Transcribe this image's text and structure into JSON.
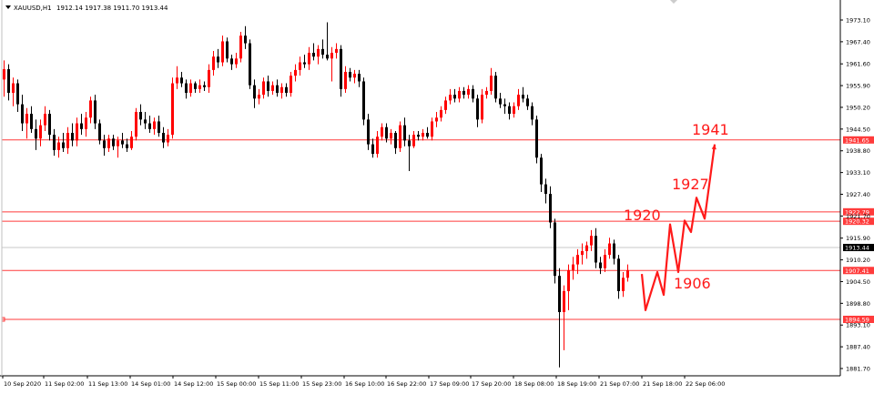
{
  "window": {
    "symbol_label": "XAUUSD,H1",
    "ohlc": "1912.14 1917.38 1911.70 1913.44"
  },
  "colors": {
    "bull": "#ff0000",
    "bear": "#000000",
    "level_line": "#ff3b3b",
    "annotation": "#ff1a1a",
    "axis": "#000000",
    "current_price_tag": "#000000"
  },
  "chart_data": {
    "type": "candlestick",
    "title": "XAUUSD,H1",
    "ohlc_readout": "1912.14 1917.38 1911.70 1913.44",
    "ylim": [
      1879.0,
      1977.0
    ],
    "y_ticks": [
      "1973.10",
      "1967.40",
      "1961.60",
      "1955.90",
      "1950.20",
      "1944.50",
      "1938.80",
      "1933.10",
      "1927.40",
      "1921.70",
      "1915.90",
      "1910.20",
      "1904.50",
      "1898.80",
      "1893.10",
      "1887.40",
      "1881.70"
    ],
    "x_ticks": [
      "10 Sep 2020",
      "11 Sep 02:00",
      "11 Sep 13:00",
      "14 Sep 01:00",
      "14 Sep 12:00",
      "15 Sep 00:00",
      "15 Sep 11:00",
      "15 Sep 23:00",
      "16 Sep 10:00",
      "16 Sep 22:00",
      "17 Sep 09:00",
      "17 Sep 20:00",
      "18 Sep 08:00",
      "18 Sep 19:00",
      "21 Sep 07:00",
      "21 Sep 18:00",
      "22 Sep 06:00"
    ],
    "levels": [
      {
        "label": "1941.65",
        "value": 1941.65
      },
      {
        "label": "1922.79",
        "value": 1922.79
      },
      {
        "label": "1920.32",
        "value": 1920.32
      },
      {
        "label": "1907.41",
        "value": 1907.41
      },
      {
        "label": "1894.59",
        "value": 1894.59
      }
    ],
    "current_price": {
      "label": "1913.44",
      "value": 1913.44
    },
    "annotations": [
      {
        "text": "1941"
      },
      {
        "text": "1927"
      },
      {
        "text": "1920"
      },
      {
        "text": "1906"
      }
    ],
    "projection_path": [
      1906.5,
      1897.0,
      1907.0,
      1901.0,
      1919.5,
      1907.0,
      1920.5,
      1917.5,
      1926.5,
      1921.0,
      1940.5
    ],
    "candles": [
      {
        "o": 1957.5,
        "h": 1962.5,
        "l": 1953.0,
        "c": 1960.2
      },
      {
        "o": 1960.2,
        "h": 1961.5,
        "l": 1952.0,
        "c": 1954.0
      },
      {
        "o": 1954.0,
        "h": 1958.0,
        "l": 1950.5,
        "c": 1956.5
      },
      {
        "o": 1956.5,
        "h": 1957.5,
        "l": 1949.0,
        "c": 1951.0
      },
      {
        "o": 1951.0,
        "h": 1953.5,
        "l": 1944.0,
        "c": 1946.0
      },
      {
        "o": 1946.0,
        "h": 1950.0,
        "l": 1942.0,
        "c": 1948.5
      },
      {
        "o": 1948.5,
        "h": 1950.5,
        "l": 1943.5,
        "c": 1944.5
      },
      {
        "o": 1944.5,
        "h": 1947.0,
        "l": 1939.0,
        "c": 1942.0
      },
      {
        "o": 1942.0,
        "h": 1947.0,
        "l": 1940.0,
        "c": 1945.5
      },
      {
        "o": 1945.5,
        "h": 1950.5,
        "l": 1944.0,
        "c": 1948.5
      },
      {
        "o": 1948.5,
        "h": 1949.5,
        "l": 1941.5,
        "c": 1943.0
      },
      {
        "o": 1943.0,
        "h": 1944.5,
        "l": 1937.5,
        "c": 1939.0
      },
      {
        "o": 1939.0,
        "h": 1942.5,
        "l": 1937.0,
        "c": 1941.0
      },
      {
        "o": 1941.0,
        "h": 1943.5,
        "l": 1938.5,
        "c": 1939.5
      },
      {
        "o": 1939.5,
        "h": 1945.0,
        "l": 1938.0,
        "c": 1943.5
      },
      {
        "o": 1943.5,
        "h": 1946.0,
        "l": 1940.0,
        "c": 1941.5
      },
      {
        "o": 1941.5,
        "h": 1947.5,
        "l": 1940.0,
        "c": 1946.0
      },
      {
        "o": 1946.0,
        "h": 1948.5,
        "l": 1943.0,
        "c": 1944.5
      },
      {
        "o": 1944.5,
        "h": 1949.0,
        "l": 1942.5,
        "c": 1947.5
      },
      {
        "o": 1947.5,
        "h": 1953.0,
        "l": 1946.0,
        "c": 1952.0
      },
      {
        "o": 1952.0,
        "h": 1953.5,
        "l": 1944.5,
        "c": 1946.0
      },
      {
        "o": 1946.0,
        "h": 1947.0,
        "l": 1940.5,
        "c": 1941.5
      },
      {
        "o": 1941.5,
        "h": 1943.0,
        "l": 1937.5,
        "c": 1939.5
      },
      {
        "o": 1939.5,
        "h": 1943.0,
        "l": 1938.5,
        "c": 1942.0
      },
      {
        "o": 1942.0,
        "h": 1943.0,
        "l": 1939.0,
        "c": 1940.0
      },
      {
        "o": 1940.0,
        "h": 1942.5,
        "l": 1937.0,
        "c": 1941.5
      },
      {
        "o": 1941.5,
        "h": 1943.5,
        "l": 1939.5,
        "c": 1940.5
      },
      {
        "o": 1940.5,
        "h": 1942.0,
        "l": 1938.5,
        "c": 1939.5
      },
      {
        "o": 1939.5,
        "h": 1944.0,
        "l": 1939.0,
        "c": 1942.5
      },
      {
        "o": 1942.5,
        "h": 1950.0,
        "l": 1941.5,
        "c": 1949.0
      },
      {
        "o": 1949.0,
        "h": 1951.0,
        "l": 1945.5,
        "c": 1947.0
      },
      {
        "o": 1947.0,
        "h": 1949.0,
        "l": 1944.5,
        "c": 1946.0
      },
      {
        "o": 1946.0,
        "h": 1948.0,
        "l": 1943.5,
        "c": 1944.5
      },
      {
        "o": 1944.5,
        "h": 1947.5,
        "l": 1943.0,
        "c": 1946.5
      },
      {
        "o": 1946.5,
        "h": 1948.0,
        "l": 1942.5,
        "c": 1943.5
      },
      {
        "o": 1943.5,
        "h": 1945.0,
        "l": 1939.5,
        "c": 1941.0
      },
      {
        "o": 1941.0,
        "h": 1944.5,
        "l": 1940.0,
        "c": 1943.0
      },
      {
        "o": 1943.0,
        "h": 1958.0,
        "l": 1942.0,
        "c": 1956.5
      },
      {
        "o": 1956.5,
        "h": 1961.0,
        "l": 1955.0,
        "c": 1958.0
      },
      {
        "o": 1958.0,
        "h": 1959.5,
        "l": 1955.5,
        "c": 1956.5
      },
      {
        "o": 1956.5,
        "h": 1957.5,
        "l": 1952.5,
        "c": 1954.0
      },
      {
        "o": 1954.0,
        "h": 1957.5,
        "l": 1953.0,
        "c": 1956.5
      },
      {
        "o": 1956.5,
        "h": 1957.0,
        "l": 1954.0,
        "c": 1955.0
      },
      {
        "o": 1955.0,
        "h": 1957.5,
        "l": 1954.0,
        "c": 1956.0
      },
      {
        "o": 1956.0,
        "h": 1957.0,
        "l": 1954.5,
        "c": 1955.5
      },
      {
        "o": 1955.5,
        "h": 1961.5,
        "l": 1954.0,
        "c": 1960.0
      },
      {
        "o": 1960.0,
        "h": 1965.0,
        "l": 1958.5,
        "c": 1963.5
      },
      {
        "o": 1963.5,
        "h": 1965.5,
        "l": 1960.5,
        "c": 1962.0
      },
      {
        "o": 1962.0,
        "h": 1969.0,
        "l": 1961.0,
        "c": 1967.5
      },
      {
        "o": 1967.5,
        "h": 1968.5,
        "l": 1962.0,
        "c": 1963.0
      },
      {
        "o": 1963.0,
        "h": 1964.0,
        "l": 1960.0,
        "c": 1961.5
      },
      {
        "o": 1961.5,
        "h": 1964.5,
        "l": 1960.5,
        "c": 1963.0
      },
      {
        "o": 1963.0,
        "h": 1970.0,
        "l": 1962.0,
        "c": 1969.0
      },
      {
        "o": 1969.0,
        "h": 1971.5,
        "l": 1965.5,
        "c": 1967.0
      },
      {
        "o": 1967.0,
        "h": 1968.0,
        "l": 1955.0,
        "c": 1956.0
      },
      {
        "o": 1956.0,
        "h": 1957.5,
        "l": 1950.0,
        "c": 1952.5
      },
      {
        "o": 1952.5,
        "h": 1955.0,
        "l": 1951.0,
        "c": 1953.5
      },
      {
        "o": 1953.5,
        "h": 1958.0,
        "l": 1952.5,
        "c": 1957.0
      },
      {
        "o": 1957.0,
        "h": 1958.5,
        "l": 1953.0,
        "c": 1954.5
      },
      {
        "o": 1954.5,
        "h": 1957.0,
        "l": 1953.5,
        "c": 1956.0
      },
      {
        "o": 1956.0,
        "h": 1957.5,
        "l": 1953.0,
        "c": 1954.0
      },
      {
        "o": 1954.0,
        "h": 1956.5,
        "l": 1952.5,
        "c": 1955.5
      },
      {
        "o": 1955.5,
        "h": 1956.5,
        "l": 1953.0,
        "c": 1954.0
      },
      {
        "o": 1954.0,
        "h": 1959.5,
        "l": 1953.0,
        "c": 1958.5
      },
      {
        "o": 1958.5,
        "h": 1961.5,
        "l": 1957.0,
        "c": 1960.0
      },
      {
        "o": 1960.0,
        "h": 1963.5,
        "l": 1958.5,
        "c": 1962.0
      },
      {
        "o": 1962.0,
        "h": 1964.0,
        "l": 1960.5,
        "c": 1961.5
      },
      {
        "o": 1961.5,
        "h": 1966.0,
        "l": 1960.0,
        "c": 1964.5
      },
      {
        "o": 1964.5,
        "h": 1967.0,
        "l": 1962.5,
        "c": 1963.5
      },
      {
        "o": 1963.5,
        "h": 1966.5,
        "l": 1961.5,
        "c": 1965.5
      },
      {
        "o": 1965.5,
        "h": 1968.0,
        "l": 1963.0,
        "c": 1964.0
      },
      {
        "o": 1964.0,
        "h": 1972.5,
        "l": 1962.5,
        "c": 1963.0
      },
      {
        "o": 1963.0,
        "h": 1966.0,
        "l": 1957.0,
        "c": 1964.5
      },
      {
        "o": 1964.5,
        "h": 1967.0,
        "l": 1963.0,
        "c": 1965.5
      },
      {
        "o": 1965.5,
        "h": 1966.5,
        "l": 1953.0,
        "c": 1955.0
      },
      {
        "o": 1955.0,
        "h": 1961.0,
        "l": 1954.0,
        "c": 1959.5
      },
      {
        "o": 1959.5,
        "h": 1960.5,
        "l": 1957.0,
        "c": 1958.0
      },
      {
        "o": 1958.0,
        "h": 1960.0,
        "l": 1956.5,
        "c": 1959.0
      },
      {
        "o": 1959.0,
        "h": 1960.0,
        "l": 1955.5,
        "c": 1957.0
      },
      {
        "o": 1957.0,
        "h": 1958.0,
        "l": 1945.5,
        "c": 1947.0
      },
      {
        "o": 1947.0,
        "h": 1948.5,
        "l": 1939.0,
        "c": 1940.5
      },
      {
        "o": 1940.5,
        "h": 1942.0,
        "l": 1937.0,
        "c": 1938.0
      },
      {
        "o": 1938.0,
        "h": 1944.0,
        "l": 1937.0,
        "c": 1942.5
      },
      {
        "o": 1942.5,
        "h": 1946.0,
        "l": 1941.5,
        "c": 1945.0
      },
      {
        "o": 1945.0,
        "h": 1946.0,
        "l": 1941.0,
        "c": 1942.0
      },
      {
        "o": 1942.0,
        "h": 1944.5,
        "l": 1940.5,
        "c": 1943.5
      },
      {
        "o": 1943.5,
        "h": 1944.0,
        "l": 1938.0,
        "c": 1939.5
      },
      {
        "o": 1939.5,
        "h": 1946.5,
        "l": 1938.5,
        "c": 1945.5
      },
      {
        "o": 1945.5,
        "h": 1947.5,
        "l": 1940.0,
        "c": 1941.5
      },
      {
        "o": 1941.5,
        "h": 1943.0,
        "l": 1933.5,
        "c": 1940.0
      },
      {
        "o": 1940.0,
        "h": 1944.0,
        "l": 1939.5,
        "c": 1943.0
      },
      {
        "o": 1943.0,
        "h": 1944.0,
        "l": 1941.5,
        "c": 1942.5
      },
      {
        "o": 1942.5,
        "h": 1944.5,
        "l": 1941.5,
        "c": 1943.5
      },
      {
        "o": 1943.5,
        "h": 1945.0,
        "l": 1942.0,
        "c": 1942.5
      },
      {
        "o": 1942.5,
        "h": 1947.5,
        "l": 1941.5,
        "c": 1946.5
      },
      {
        "o": 1946.5,
        "h": 1949.0,
        "l": 1945.0,
        "c": 1947.5
      },
      {
        "o": 1947.5,
        "h": 1950.5,
        "l": 1946.5,
        "c": 1949.5
      },
      {
        "o": 1949.5,
        "h": 1953.0,
        "l": 1948.5,
        "c": 1952.0
      },
      {
        "o": 1952.0,
        "h": 1955.0,
        "l": 1951.0,
        "c": 1953.5
      },
      {
        "o": 1953.5,
        "h": 1955.0,
        "l": 1951.5,
        "c": 1952.5
      },
      {
        "o": 1952.5,
        "h": 1955.5,
        "l": 1951.5,
        "c": 1954.5
      },
      {
        "o": 1954.5,
        "h": 1955.5,
        "l": 1952.5,
        "c": 1953.5
      },
      {
        "o": 1953.5,
        "h": 1956.0,
        "l": 1952.5,
        "c": 1955.0
      },
      {
        "o": 1955.0,
        "h": 1956.0,
        "l": 1951.5,
        "c": 1952.5
      },
      {
        "o": 1952.5,
        "h": 1953.5,
        "l": 1945.0,
        "c": 1947.0
      },
      {
        "o": 1947.0,
        "h": 1955.0,
        "l": 1946.0,
        "c": 1953.5
      },
      {
        "o": 1953.5,
        "h": 1955.5,
        "l": 1952.5,
        "c": 1954.5
      },
      {
        "o": 1954.5,
        "h": 1960.5,
        "l": 1953.5,
        "c": 1958.5
      },
      {
        "o": 1958.5,
        "h": 1959.5,
        "l": 1951.5,
        "c": 1952.5
      },
      {
        "o": 1952.5,
        "h": 1954.0,
        "l": 1950.0,
        "c": 1951.0
      },
      {
        "o": 1951.0,
        "h": 1952.5,
        "l": 1948.5,
        "c": 1950.5
      },
      {
        "o": 1950.5,
        "h": 1951.5,
        "l": 1947.0,
        "c": 1948.5
      },
      {
        "o": 1948.5,
        "h": 1951.5,
        "l": 1947.5,
        "c": 1950.5
      },
      {
        "o": 1950.5,
        "h": 1955.0,
        "l": 1949.5,
        "c": 1953.5
      },
      {
        "o": 1953.5,
        "h": 1955.5,
        "l": 1951.5,
        "c": 1952.5
      },
      {
        "o": 1952.5,
        "h": 1953.5,
        "l": 1949.5,
        "c": 1950.5
      },
      {
        "o": 1950.5,
        "h": 1951.5,
        "l": 1945.5,
        "c": 1947.0
      },
      {
        "o": 1947.0,
        "h": 1948.0,
        "l": 1935.5,
        "c": 1937.0
      },
      {
        "o": 1937.0,
        "h": 1938.0,
        "l": 1928.0,
        "c": 1930.0
      },
      {
        "o": 1930.0,
        "h": 1931.5,
        "l": 1925.0,
        "c": 1927.5
      },
      {
        "o": 1927.5,
        "h": 1929.5,
        "l": 1918.5,
        "c": 1920.0
      },
      {
        "o": 1920.0,
        "h": 1921.0,
        "l": 1904.0,
        "c": 1906.0
      },
      {
        "o": 1906.0,
        "h": 1908.0,
        "l": 1882.0,
        "c": 1896.5
      },
      {
        "o": 1896.5,
        "h": 1903.5,
        "l": 1886.5,
        "c": 1902.0
      },
      {
        "o": 1902.0,
        "h": 1909.0,
        "l": 1897.0,
        "c": 1907.5
      },
      {
        "o": 1907.5,
        "h": 1911.0,
        "l": 1905.0,
        "c": 1909.0
      },
      {
        "o": 1909.0,
        "h": 1913.0,
        "l": 1906.5,
        "c": 1911.5
      },
      {
        "o": 1911.5,
        "h": 1914.5,
        "l": 1909.0,
        "c": 1912.5
      },
      {
        "o": 1912.5,
        "h": 1915.0,
        "l": 1910.5,
        "c": 1914.0
      },
      {
        "o": 1914.0,
        "h": 1918.0,
        "l": 1912.5,
        "c": 1916.5
      },
      {
        "o": 1916.5,
        "h": 1918.5,
        "l": 1908.0,
        "c": 1909.5
      },
      {
        "o": 1909.5,
        "h": 1911.0,
        "l": 1906.5,
        "c": 1908.0
      },
      {
        "o": 1908.0,
        "h": 1913.0,
        "l": 1907.0,
        "c": 1911.5
      },
      {
        "o": 1911.5,
        "h": 1916.0,
        "l": 1910.5,
        "c": 1914.5
      },
      {
        "o": 1914.5,
        "h": 1915.5,
        "l": 1909.0,
        "c": 1910.5
      },
      {
        "o": 1910.5,
        "h": 1911.5,
        "l": 1900.0,
        "c": 1902.0
      },
      {
        "o": 1902.0,
        "h": 1907.0,
        "l": 1900.5,
        "c": 1905.5
      },
      {
        "o": 1905.5,
        "h": 1909.0,
        "l": 1904.5,
        "c": 1907.5
      }
    ]
  }
}
